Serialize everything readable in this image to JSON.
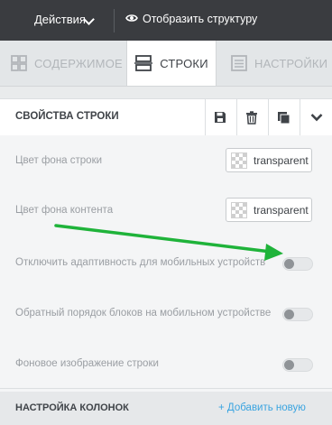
{
  "topbar": {
    "actions_label": "Действия",
    "structure_label": "Отобразить структуру",
    "eye_icon": "eye-icon",
    "chevron_icon": "chevron-down-icon"
  },
  "tabs": [
    {
      "label": "СОДЕРЖИМОЕ",
      "icon": "grid-icon",
      "active": false
    },
    {
      "label": "СТРОКИ",
      "icon": "rows-icon",
      "active": true
    },
    {
      "label": "НАСТРОЙКИ",
      "icon": "settings-doc-icon",
      "active": false
    }
  ],
  "panel": {
    "title": "СВОЙСТВА СТРОКИ",
    "header_icons": [
      "save-icon",
      "trash-icon",
      "copy-icon",
      "chevron-down-icon"
    ],
    "rows": [
      {
        "label": "Цвет фона строки",
        "type": "color",
        "value": "transparent"
      },
      {
        "label": "Цвет фона контента",
        "type": "color",
        "value": "transparent"
      },
      {
        "label": "Отключить адаптивность для мобильных устройств",
        "type": "toggle",
        "on": false
      },
      {
        "label": "Обратный порядок блоков на мобильном устройстве",
        "type": "toggle",
        "on": false
      },
      {
        "label": "Фоновое изображение строки",
        "type": "toggle",
        "on": false
      }
    ],
    "columns_title": "НАСТРОЙКА КОЛОНОК",
    "add_new": "+ Добавить новую"
  },
  "colors": {
    "topbar_bg": "#3a3c40",
    "accent_link": "#3aa4e0",
    "annotation_arrow": "#1fb33a"
  }
}
